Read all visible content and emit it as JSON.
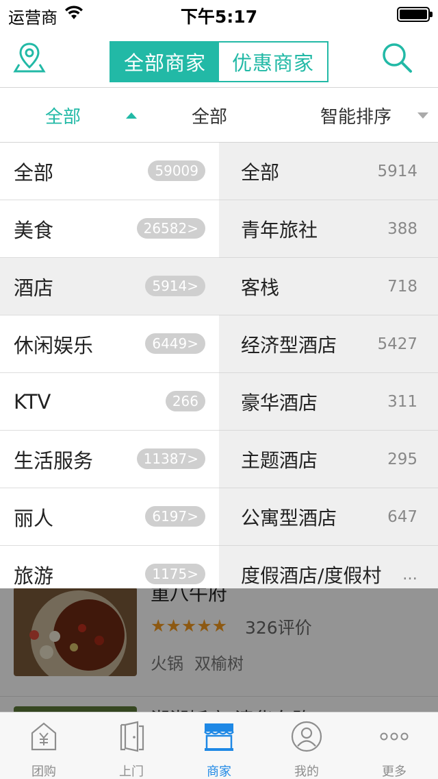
{
  "status_bar": {
    "carrier": "运营商",
    "time": "下午5:17"
  },
  "nav": {
    "segments": [
      "全部商家",
      "优惠商家"
    ],
    "active_segment": 0
  },
  "filters": {
    "category": "全部",
    "area": "全部",
    "sort": "智能排序"
  },
  "categories": [
    {
      "label": "全部",
      "count": "59009"
    },
    {
      "label": "美食",
      "count": "26582>"
    },
    {
      "label": "酒店",
      "count": "5914>"
    },
    {
      "label": "休闲娱乐",
      "count": "6449>"
    },
    {
      "label": "KTV",
      "count": "266"
    },
    {
      "label": "生活服务",
      "count": "11387>"
    },
    {
      "label": "丽人",
      "count": "6197>"
    },
    {
      "label": "旅游",
      "count": "1175>"
    }
  ],
  "selected_category": 2,
  "subcategories": [
    {
      "label": "全部",
      "count": "5914"
    },
    {
      "label": "青年旅社",
      "count": "388"
    },
    {
      "label": "客栈",
      "count": "718"
    },
    {
      "label": "经济型酒店",
      "count": "5427"
    },
    {
      "label": "豪华酒店",
      "count": "311"
    },
    {
      "label": "主题酒店",
      "count": "295"
    },
    {
      "label": "公寓型酒店",
      "count": "647"
    },
    {
      "label": "度假酒店/度假村",
      "count": "..."
    }
  ],
  "background_shop": {
    "name": "重八牛府",
    "stars": "★★★★★",
    "reviews": "326评价",
    "tags": [
      "火锅",
      "双榆树"
    ],
    "next_name": "湘湘饭店(清华东路)"
  },
  "tabbar": {
    "items": [
      {
        "label": "团购",
        "icon": "tuangou-icon"
      },
      {
        "label": "上门",
        "icon": "door-icon"
      },
      {
        "label": "商家",
        "icon": "store-icon"
      },
      {
        "label": "我的",
        "icon": "profile-icon"
      },
      {
        "label": "更多",
        "icon": "more-icon"
      }
    ],
    "active": 2
  },
  "colors": {
    "accent": "#22b9a6",
    "tab_active": "#1e88e5",
    "star": "#f39a1f"
  }
}
